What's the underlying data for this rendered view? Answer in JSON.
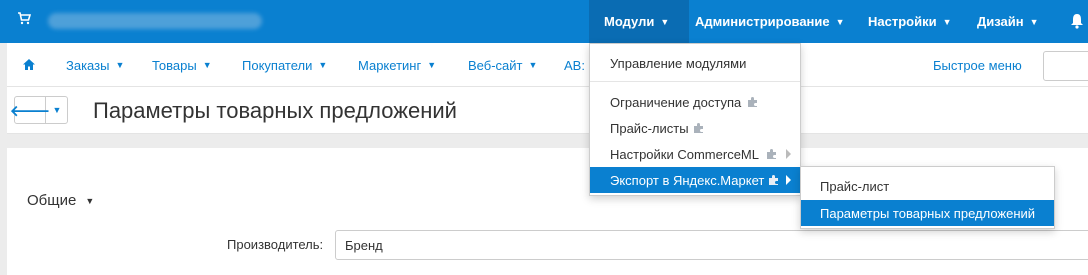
{
  "topbar": {
    "menus": [
      {
        "label": "Модули"
      },
      {
        "label": "Администрирование"
      },
      {
        "label": "Настройки"
      },
      {
        "label": "Дизайн"
      }
    ]
  },
  "navbar": {
    "items": [
      {
        "label": "Заказы"
      },
      {
        "label": "Товары"
      },
      {
        "label": "Покупатели"
      },
      {
        "label": "Маркетинг"
      },
      {
        "label": "Веб-сайт"
      },
      {
        "label": "AB:"
      }
    ],
    "quick_menu": "Быстрое меню"
  },
  "page": {
    "title": "Параметры товарных предложений"
  },
  "content": {
    "section_label": "Общие",
    "field_label": "Производитель:",
    "field_value": "Бренд"
  },
  "modules_menu": {
    "items": [
      {
        "label": "Управление модулями"
      },
      {
        "label": "Ограничение доступа"
      },
      {
        "label": "Прайс-листы"
      },
      {
        "label": "Настройки CommerceML"
      },
      {
        "label": "Экспорт в Яндекс.Маркет"
      }
    ]
  },
  "submenu": {
    "items": [
      {
        "label": "Прайс-лист"
      },
      {
        "label": "Параметры товарных предложений"
      }
    ]
  },
  "colors": {
    "accent": "#0a80d0",
    "topbar": "#0a80d0"
  }
}
